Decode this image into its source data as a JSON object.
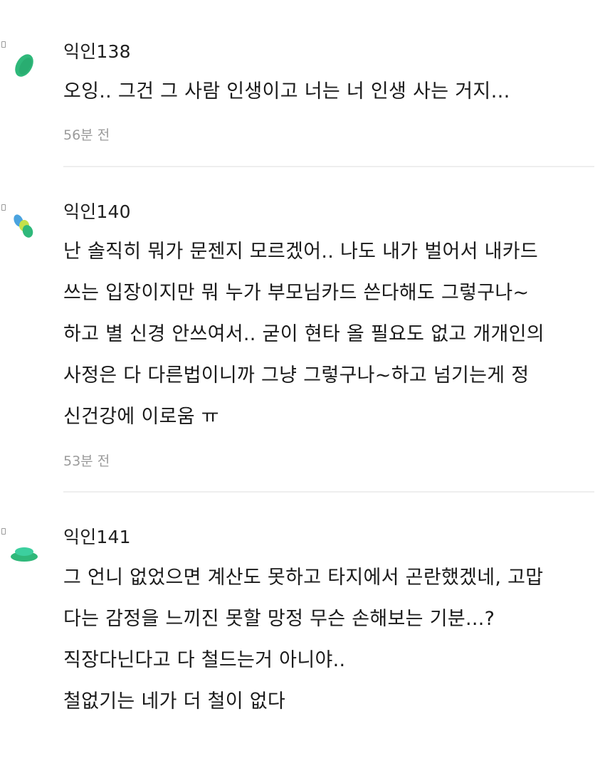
{
  "comments": [
    {
      "author": "익인138",
      "avatar_icon": "green-oval-avatar-icon",
      "lines": [
        "오잉.. 그건 그 사람 인생이고 너는 너 인생 사는 거지…"
      ],
      "time": "56분 전"
    },
    {
      "author": "익인140",
      "avatar_icon": "multicolor-dots-avatar-icon",
      "lines": [
        "난 솔직히 뭐가 문젠지 모르겠어.. 나도 내가 벌어서 내카드",
        "쓰는 입장이지만 뭐 누가 부모님카드 쓴다해도 그렇구나~",
        "하고 별 신경 안쓰여서.. 굳이 현타 올 필요도 없고 개개인의",
        "사정은 다 다른법이니까 그냥 그렇구나~하고 넘기는게 정",
        "신건강에 이로움 ㅠ"
      ],
      "time": "53분 전"
    },
    {
      "author": "익인141",
      "avatar_icon": "green-disc-avatar-icon",
      "lines": [
        "그 언니 없었으면 계산도 못하고 타지에서 곤란했겠네, 고맙",
        "다는 감정을 느끼진 못할 망정 무슨 손해보는 기분...?",
        "직장다닌다고 다 철드는거 아니야..",
        "철없기는 네가 더 철이 없다"
      ]
    }
  ],
  "colors": {
    "avatar_green": "#2fb87a",
    "avatar_green_dark": "#25a46a",
    "avatar_blue": "#4aa3df",
    "avatar_lime": "#c4e04b",
    "avatar_mint": "#3ccf9e",
    "divider": "#eeeeee",
    "time_text": "#9b9b9b"
  }
}
